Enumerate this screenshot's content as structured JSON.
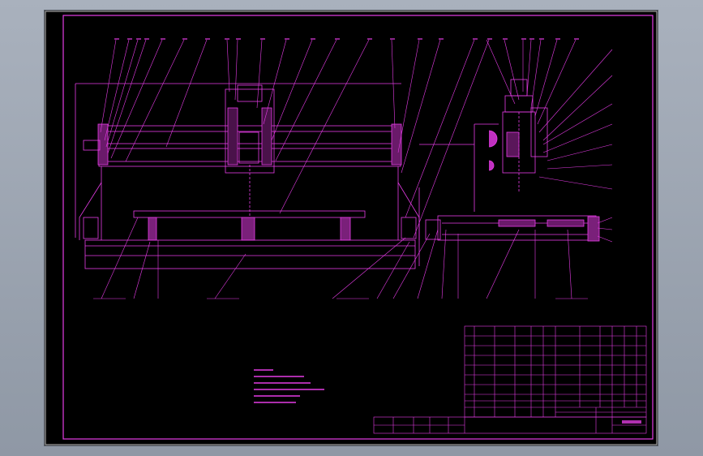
{
  "drawing": {
    "sheet_id": "drawing-sheet",
    "line_color": "#e63ce6",
    "paper_color": "#000000",
    "background_color": "#9aa3ae",
    "title_block_text": "",
    "tech_notes": [
      "",
      "",
      "",
      "",
      ""
    ]
  }
}
